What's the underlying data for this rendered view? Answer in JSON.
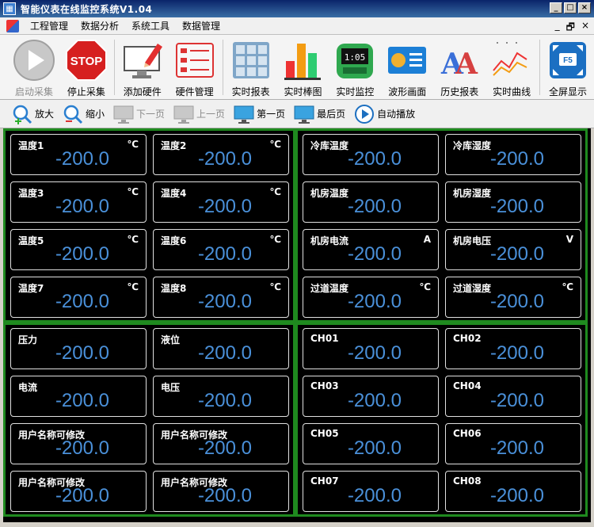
{
  "window": {
    "title": "智能仪表在线监控系统V1.04",
    "buttons": [
      "_",
      "□",
      "×"
    ]
  },
  "menu": {
    "items": [
      "工程管理",
      "数据分析",
      "系统工具",
      "数据管理"
    ],
    "mdi": [
      "_",
      "🗗",
      "×"
    ]
  },
  "toolbar": [
    {
      "label": "启动采集",
      "icon": "play-icon",
      "enabled": false
    },
    {
      "label": "停止采集",
      "icon": "stop-sign-icon",
      "enabled": true
    },
    {
      "label": "添加硬件",
      "icon": "monitor-pencil-icon",
      "enabled": true
    },
    {
      "label": "硬件管理",
      "icon": "list-icon",
      "enabled": true
    },
    {
      "label": "实时报表",
      "icon": "grid-table-icon",
      "enabled": true
    },
    {
      "label": "实时棒图",
      "icon": "bar-chart-icon",
      "enabled": true
    },
    {
      "label": "实时监控",
      "icon": "digital-meter-icon",
      "enabled": true
    },
    {
      "label": "波形画面",
      "icon": "waveform-icon",
      "enabled": true
    },
    {
      "label": "历史报表",
      "icon": "history-report-icon",
      "enabled": true
    },
    {
      "label": "实时曲线",
      "icon": "line-chart-icon",
      "enabled": true
    },
    {
      "label": "全屏显示",
      "icon": "fullscreen-f5-icon",
      "enabled": true
    }
  ],
  "nav": [
    {
      "label": "放大",
      "icon": "zoom-in-icon",
      "enabled": true
    },
    {
      "label": "缩小",
      "icon": "zoom-out-icon",
      "enabled": true
    },
    {
      "label": "下一页",
      "icon": "monitor-icon",
      "enabled": false
    },
    {
      "label": "上一页",
      "icon": "monitor-icon",
      "enabled": false
    },
    {
      "label": "第一页",
      "icon": "monitor-icon",
      "enabled": true
    },
    {
      "label": "最后页",
      "icon": "monitor-icon",
      "enabled": true
    },
    {
      "label": "自动播放",
      "icon": "play-circle-icon",
      "enabled": true
    }
  ],
  "panels": [
    {
      "cards": [
        {
          "name": "温度1",
          "unit": "℃",
          "value": "-200.0"
        },
        {
          "name": "温度2",
          "unit": "℃",
          "value": "-200.0"
        },
        {
          "name": "温度3",
          "unit": "℃",
          "value": "-200.0"
        },
        {
          "name": "温度4",
          "unit": "℃",
          "value": "-200.0"
        },
        {
          "name": "温度5",
          "unit": "℃",
          "value": "-200.0"
        },
        {
          "name": "温度6",
          "unit": "℃",
          "value": "-200.0"
        },
        {
          "name": "温度7",
          "unit": "℃",
          "value": "-200.0"
        },
        {
          "name": "温度8",
          "unit": "℃",
          "value": "-200.0"
        }
      ]
    },
    {
      "cards": [
        {
          "name": "冷库温度",
          "unit": "",
          "value": "-200.0"
        },
        {
          "name": "冷库湿度",
          "unit": "",
          "value": "-200.0"
        },
        {
          "name": "机房温度",
          "unit": "",
          "value": "-200.0"
        },
        {
          "name": "机房湿度",
          "unit": "",
          "value": "-200.0"
        },
        {
          "name": "机房电流",
          "unit": "A",
          "value": "-200.0"
        },
        {
          "name": "机房电压",
          "unit": "V",
          "value": "-200.0"
        },
        {
          "name": "过道温度",
          "unit": "℃",
          "value": "-200.0"
        },
        {
          "name": "过道湿度",
          "unit": "℃",
          "value": "-200.0"
        }
      ]
    },
    {
      "cards": [
        {
          "name": "压力",
          "unit": "",
          "value": "-200.0"
        },
        {
          "name": "液位",
          "unit": "",
          "value": "-200.0"
        },
        {
          "name": "电流",
          "unit": "",
          "value": "-200.0"
        },
        {
          "name": "电压",
          "unit": "",
          "value": "-200.0"
        },
        {
          "name": "用户名称可修改",
          "unit": "",
          "value": "-200.0"
        },
        {
          "name": "用户名称可修改",
          "unit": "",
          "value": "-200.0"
        },
        {
          "name": "用户名称可修改",
          "unit": "",
          "value": "-200.0"
        },
        {
          "name": "用户名称可修改",
          "unit": "",
          "value": "-200.0"
        }
      ]
    },
    {
      "cards": [
        {
          "name": "CH01",
          "unit": "",
          "value": "-200.0"
        },
        {
          "name": "CH02",
          "unit": "",
          "value": "-200.0"
        },
        {
          "name": "CH03",
          "unit": "",
          "value": "-200.0"
        },
        {
          "name": "CH04",
          "unit": "",
          "value": "-200.0"
        },
        {
          "name": "CH05",
          "unit": "",
          "value": "-200.0"
        },
        {
          "name": "CH06",
          "unit": "",
          "value": "-200.0"
        },
        {
          "name": "CH07",
          "unit": "",
          "value": "-200.0"
        },
        {
          "name": "CH08",
          "unit": "",
          "value": "-200.0"
        }
      ]
    }
  ],
  "colors": {
    "panel_border": "#1f8a1f",
    "value_text": "#4a90d9",
    "card_border": "#e0e0e0"
  }
}
